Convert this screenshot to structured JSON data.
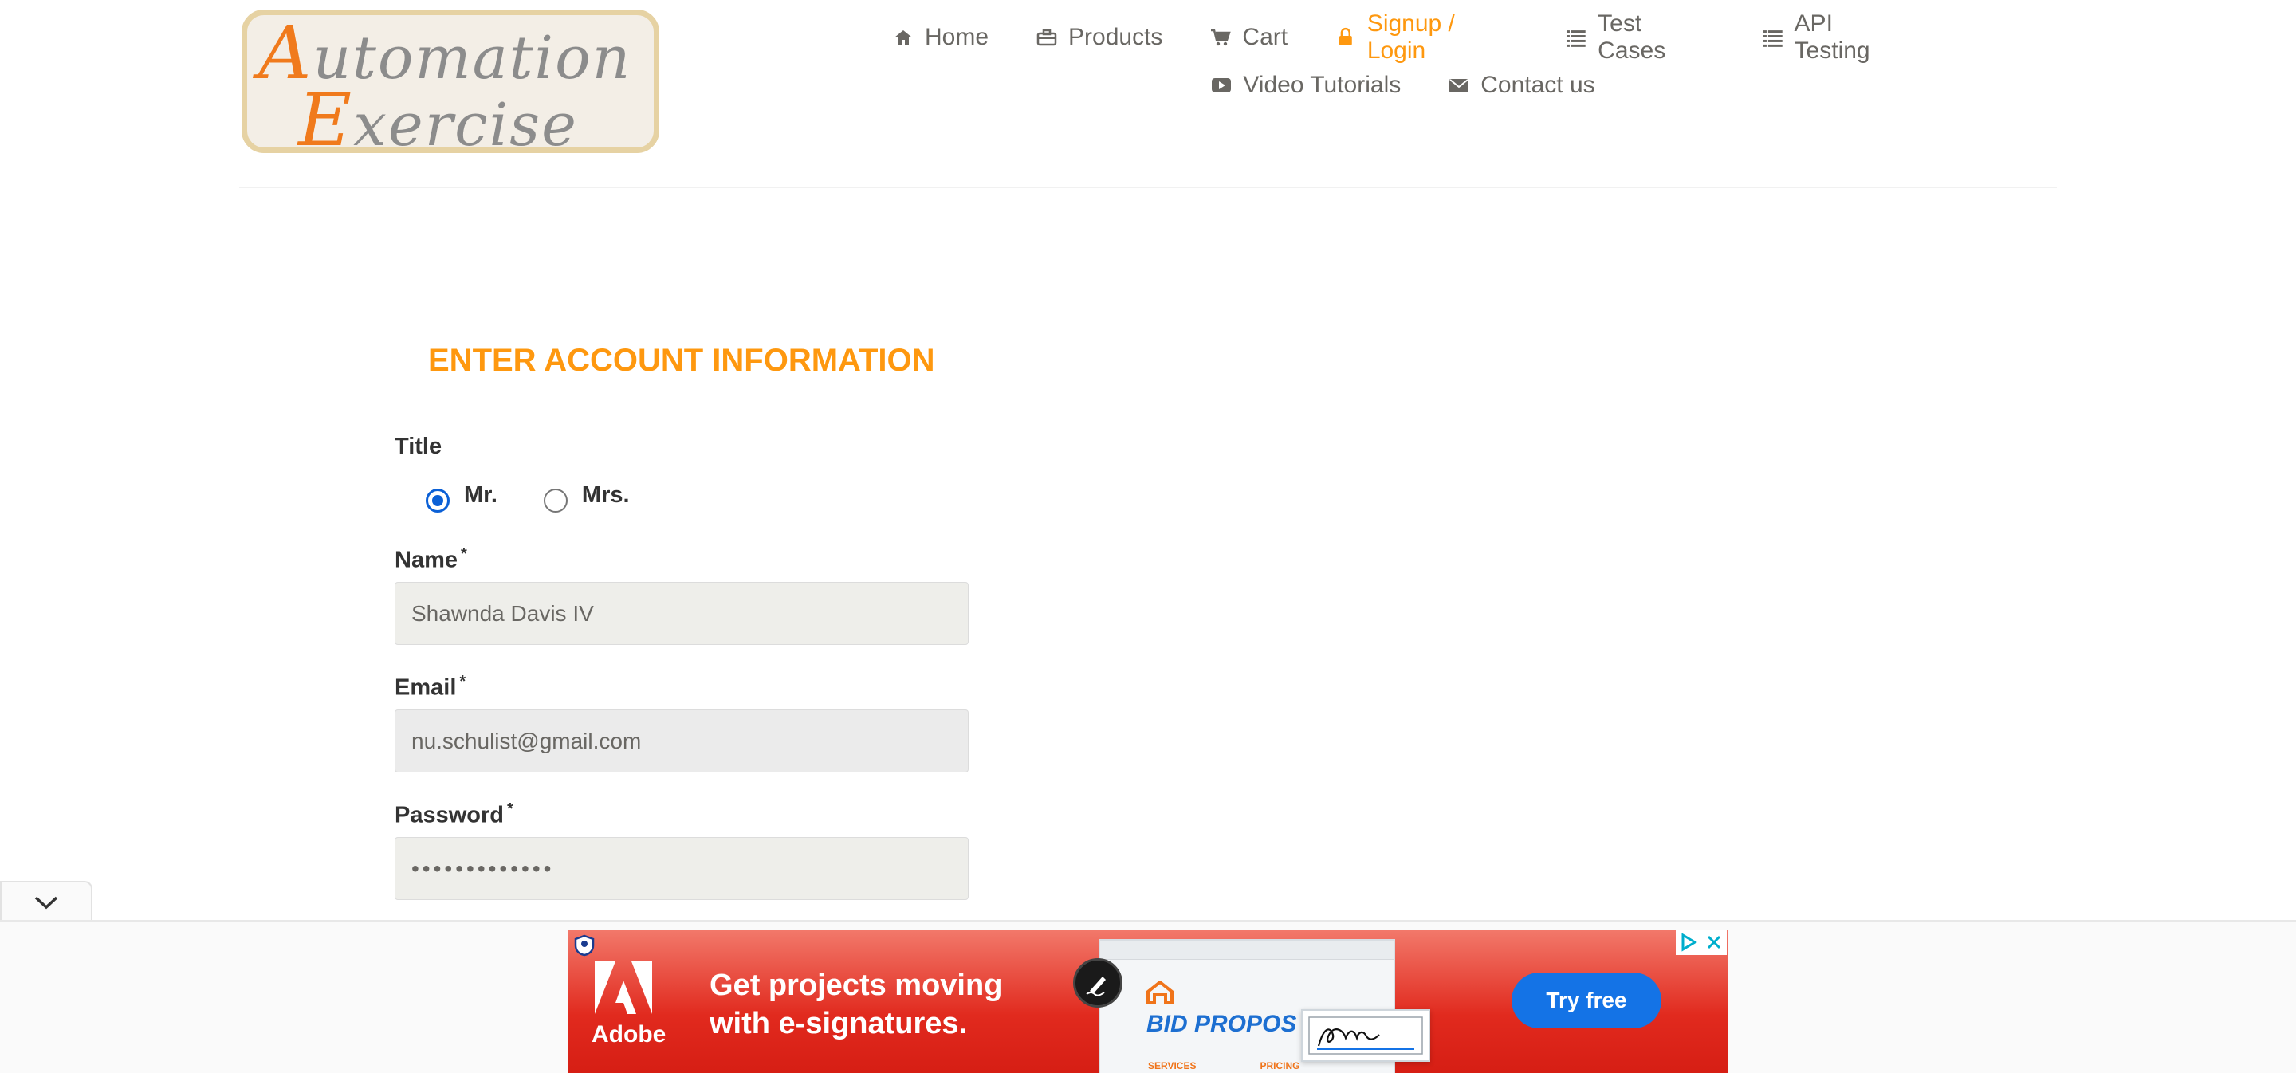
{
  "logo": {
    "line1_initial": "A",
    "line1_rest": "utomation",
    "line2_initial": "E",
    "line2_rest": "xercise"
  },
  "nav": {
    "row1": [
      {
        "label": "Home",
        "icon": "home-icon"
      },
      {
        "label": "Products",
        "icon": "briefcase-icon"
      },
      {
        "label": "Cart",
        "icon": "cart-icon"
      },
      {
        "label": "Signup / Login",
        "icon": "lock-icon",
        "active": true
      },
      {
        "label": "Test Cases",
        "icon": "list-icon"
      },
      {
        "label": "API Testing",
        "icon": "list-icon"
      }
    ],
    "row2": [
      {
        "label": "Video Tutorials",
        "icon": "youtube-icon"
      },
      {
        "label": "Contact us",
        "icon": "envelope-icon"
      }
    ]
  },
  "form": {
    "heading": "ENTER ACCOUNT INFORMATION",
    "title_label": "Title",
    "title_options": [
      {
        "label": "Mr.",
        "checked": true
      },
      {
        "label": "Mrs.",
        "checked": false
      }
    ],
    "name_label": "Name",
    "name_value": "Shawnda Davis IV",
    "email_label": "Email",
    "email_value": "nu.schulist@gmail.com",
    "password_label": "Password",
    "password_value": "•••••••••••••",
    "required_mark": "*"
  },
  "ad": {
    "brand": "Adobe",
    "headline_line1": "Get projects moving",
    "headline_line2": "with e-signatures.",
    "preview_title": "BID PROPOS",
    "preview_col1": "SERVICES",
    "preview_col2": "PRICING",
    "cta": "Try free"
  },
  "colors": {
    "accent": "#fe980f",
    "nav_text": "#696763",
    "radio_checked": "#0b60d6",
    "ad_cta": "#1473e6"
  }
}
